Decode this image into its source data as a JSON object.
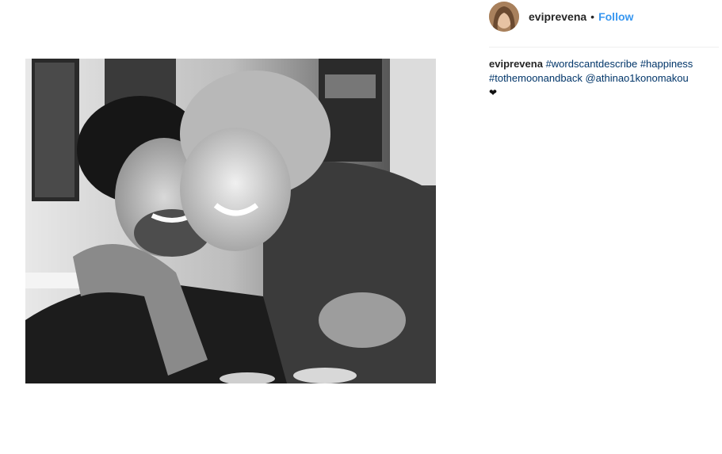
{
  "post": {
    "author": {
      "username": "eviprevena",
      "separator": "•",
      "follow_label": "Follow"
    },
    "caption": {
      "username": "eviprevena",
      "parts": [
        {
          "type": "hashtag",
          "text": "#wordscantdescribe"
        },
        {
          "type": "hashtag",
          "text": "#happiness"
        },
        {
          "type": "hashtag",
          "text": "#tothemoonandback"
        },
        {
          "type": "mention",
          "text": "@athinao1konomakou"
        }
      ],
      "emoji": "❤"
    },
    "colors": {
      "follow": "#3897f0",
      "link": "#003569",
      "text": "#262626",
      "divider": "#efefef"
    },
    "icons": {
      "avatar": "profile-photo",
      "heart": "black-heart-emoji"
    }
  }
}
